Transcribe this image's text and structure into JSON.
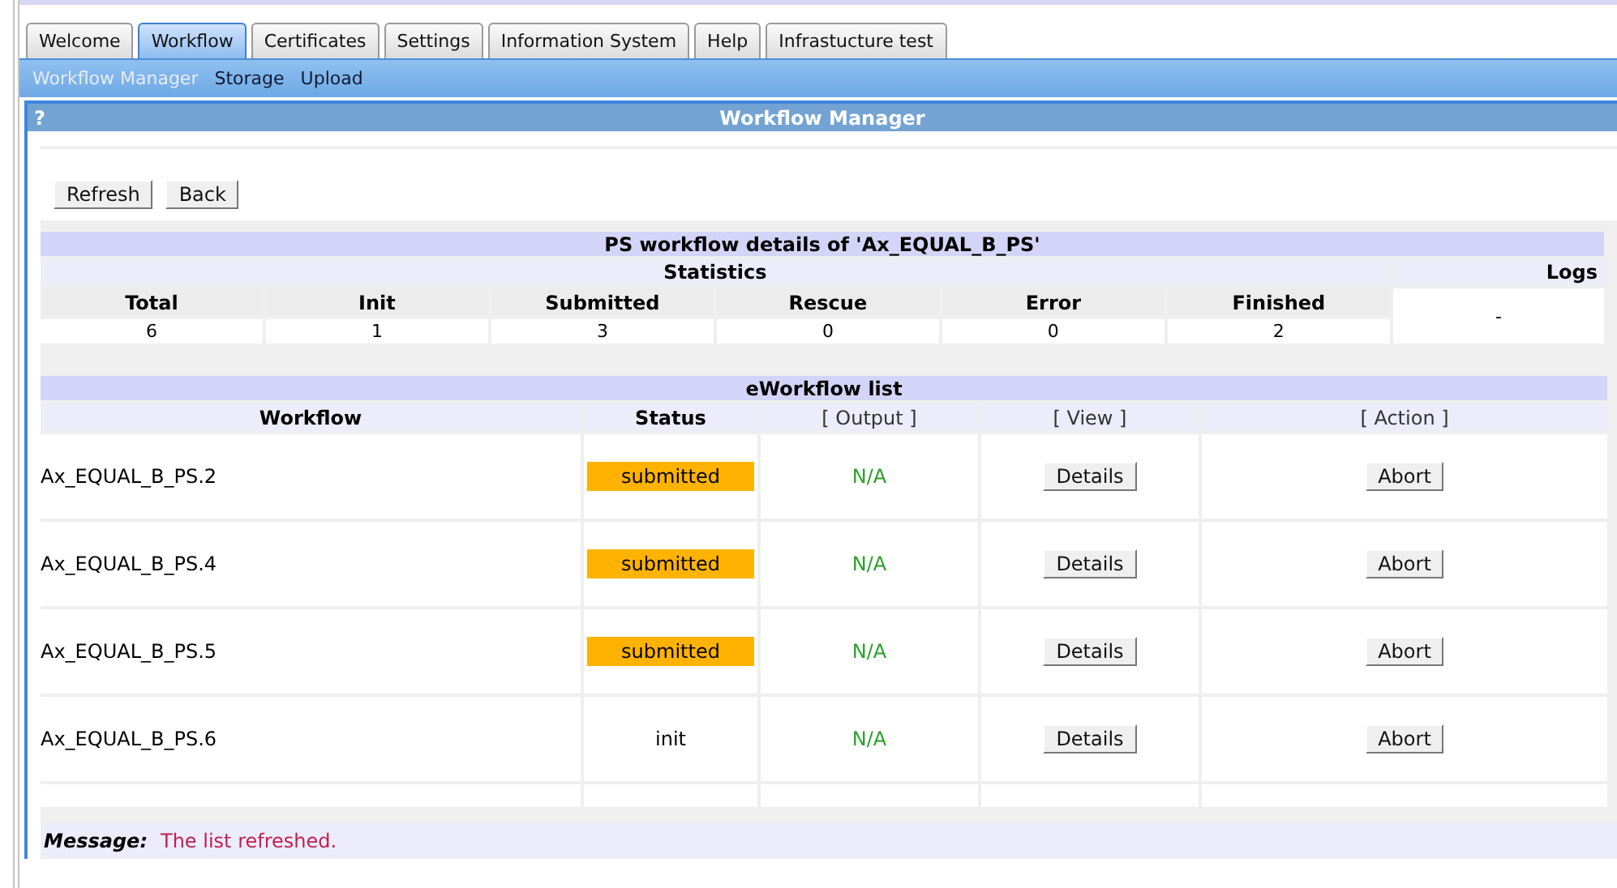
{
  "tabs": [
    {
      "label": "Welcome",
      "selected": false
    },
    {
      "label": "Workflow",
      "selected": true
    },
    {
      "label": "Certificates",
      "selected": false
    },
    {
      "label": "Settings",
      "selected": false
    },
    {
      "label": "Information System",
      "selected": false
    },
    {
      "label": "Help",
      "selected": false
    },
    {
      "label": "Infrastucture test",
      "selected": false
    }
  ],
  "subnav": [
    {
      "label": "Workflow Manager",
      "selected": true
    },
    {
      "label": "Storage",
      "selected": false
    },
    {
      "label": "Upload",
      "selected": false
    }
  ],
  "panel": {
    "help": "?",
    "title": "Workflow Manager"
  },
  "toolbar": [
    "Refresh",
    "Back"
  ],
  "details": {
    "title": "PS workflow details of 'Ax_EQUAL_B_PS'",
    "statistics_heading": "Statistics",
    "logs_heading": "Logs",
    "logs_value": "-",
    "stats": [
      {
        "label": "Total",
        "value": "6"
      },
      {
        "label": "Init",
        "value": "1"
      },
      {
        "label": "Submitted",
        "value": "3"
      },
      {
        "label": "Rescue",
        "value": "0"
      },
      {
        "label": "Error",
        "value": "0"
      },
      {
        "label": "Finished",
        "value": "2"
      }
    ]
  },
  "list": {
    "title": "eWorkflow list",
    "columns": [
      {
        "label": "Workflow",
        "kind": "bold"
      },
      {
        "label": "Status",
        "kind": "bold"
      },
      {
        "label": "[ Output ]",
        "kind": "plain"
      },
      {
        "label": "[ View ]",
        "kind": "plain"
      },
      {
        "label": "[ Action ]",
        "kind": "plain"
      }
    ],
    "rows": [
      {
        "workflow": "Ax_EQUAL_B_PS.2",
        "status": {
          "label": "submitted",
          "kind": "submitted"
        },
        "output": "N/A",
        "view": "Details",
        "action": "Abort"
      },
      {
        "workflow": "Ax_EQUAL_B_PS.4",
        "status": {
          "label": "submitted",
          "kind": "submitted"
        },
        "output": "N/A",
        "view": "Details",
        "action": "Abort"
      },
      {
        "workflow": "Ax_EQUAL_B_PS.5",
        "status": {
          "label": "submitted",
          "kind": "submitted"
        },
        "output": "N/A",
        "view": "Details",
        "action": "Abort"
      },
      {
        "workflow": "Ax_EQUAL_B_PS.6",
        "status": {
          "label": "init",
          "kind": "init"
        },
        "output": "N/A",
        "view": "Details",
        "action": "Abort"
      }
    ]
  },
  "message": {
    "label": "Message:",
    "text": "The list refreshed."
  }
}
